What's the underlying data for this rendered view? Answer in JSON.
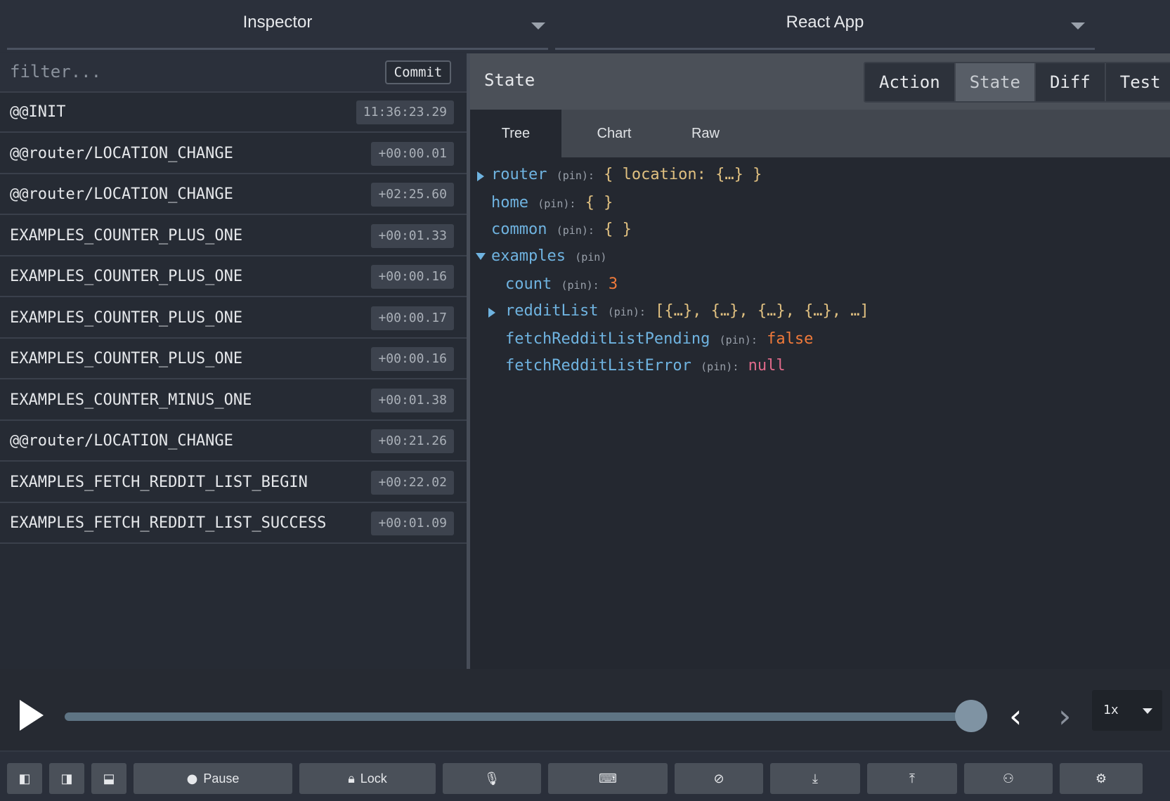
{
  "header": {
    "left_select": "Inspector",
    "right_select": "React App"
  },
  "actions_panel": {
    "filter_placeholder": "filter...",
    "commit_label": "Commit",
    "items": [
      {
        "name": "@@INIT",
        "time": "11:36:23.29"
      },
      {
        "name": "@@router/LOCATION_CHANGE",
        "time": "+00:00.01"
      },
      {
        "name": "@@router/LOCATION_CHANGE",
        "time": "+02:25.60"
      },
      {
        "name": "EXAMPLES_COUNTER_PLUS_ONE",
        "time": "+00:01.33"
      },
      {
        "name": "EXAMPLES_COUNTER_PLUS_ONE",
        "time": "+00:00.16"
      },
      {
        "name": "EXAMPLES_COUNTER_PLUS_ONE",
        "time": "+00:00.17"
      },
      {
        "name": "EXAMPLES_COUNTER_PLUS_ONE",
        "time": "+00:00.16"
      },
      {
        "name": "EXAMPLES_COUNTER_MINUS_ONE",
        "time": "+00:01.38"
      },
      {
        "name": "@@router/LOCATION_CHANGE",
        "time": "+00:21.26"
      },
      {
        "name": "EXAMPLES_FETCH_REDDIT_LIST_BEGIN",
        "time": "+00:22.02"
      },
      {
        "name": "EXAMPLES_FETCH_REDDIT_LIST_SUCCESS",
        "time": "+00:01.09"
      }
    ]
  },
  "monitor": {
    "title": "State",
    "tabs": [
      "Action",
      "State",
      "Diff",
      "Test"
    ],
    "active_tab": "State",
    "subtabs": [
      "Tree",
      "Chart",
      "Raw"
    ],
    "active_subtab": "Tree"
  },
  "tree": {
    "router_key": "router",
    "router_value": "{ location: {…} }",
    "home_key": "home",
    "home_value": "{ }",
    "common_key": "common",
    "common_value": "{ }",
    "examples_key": "examples",
    "count_key": "count",
    "count_value": "3",
    "redditList_key": "redditList",
    "redditList_value": "[{…}, {…}, {…}, {…}, …]",
    "pending_key": "fetchRedditListPending",
    "pending_value": "false",
    "error_key": "fetchRedditListError",
    "error_value": "null",
    "pin_label": "(pin)"
  },
  "slider": {
    "progress": 1.0,
    "speed": "1x"
  },
  "bottom_buttons": {
    "pause_label": "Pause",
    "lock_label": "Lock"
  },
  "colors": {
    "key": "#6fb3e0",
    "number": "#f07a3a",
    "null": "#e06a8a",
    "track": "#5e7484",
    "thumb": "#7f93a3"
  }
}
